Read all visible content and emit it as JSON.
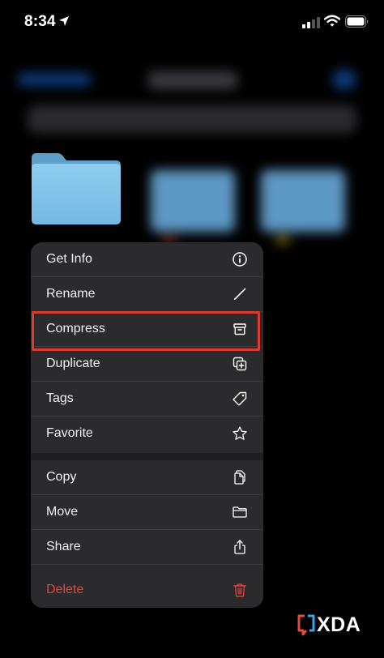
{
  "status_bar": {
    "time": "8:34",
    "icons": [
      "location-arrow-icon",
      "cellular-signal-icon",
      "wifi-icon",
      "battery-icon"
    ]
  },
  "menu": {
    "groups": [
      [
        {
          "label": "Get Info",
          "icon": "info-circle-icon"
        },
        {
          "label": "Rename",
          "icon": "pencil-icon"
        },
        {
          "label": "Compress",
          "icon": "archive-box-icon"
        },
        {
          "label": "Duplicate",
          "icon": "duplicate-icon"
        },
        {
          "label": "Tags",
          "icon": "tag-icon"
        },
        {
          "label": "Favorite",
          "icon": "star-icon"
        }
      ],
      [
        {
          "label": "Copy",
          "icon": "copy-documents-icon"
        },
        {
          "label": "Move",
          "icon": "folder-icon"
        },
        {
          "label": "Share",
          "icon": "share-icon"
        },
        {
          "label": "Delete",
          "icon": "trash-icon"
        }
      ]
    ],
    "highlighted_item": "Compress"
  },
  "watermark": {
    "text": "XDA"
  },
  "colors": {
    "menu_bg": "#2b2b2d",
    "delete": "#e5443e",
    "highlight": "#dd3b30",
    "folder": "#7cc0e6"
  }
}
